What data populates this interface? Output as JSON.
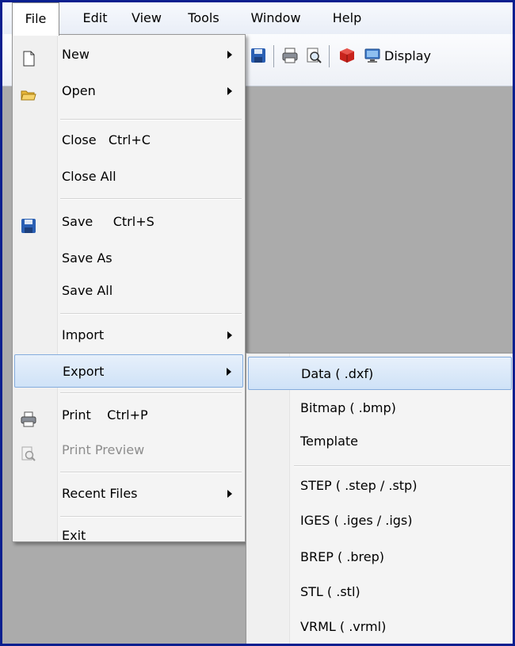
{
  "menubar": {
    "items": [
      {
        "label": "File"
      },
      {
        "label": "Edit"
      },
      {
        "label": "View"
      },
      {
        "label": "Tools"
      },
      {
        "label": "Window"
      },
      {
        "label": "Help"
      }
    ]
  },
  "toolbar": {
    "display_label": "Display"
  },
  "file_menu": {
    "new": "New",
    "open": "Open",
    "close": "Close",
    "close_shortcut": "Ctrl+C",
    "close_all": "Close All",
    "save": "Save",
    "save_shortcut": "Ctrl+S",
    "save_as": "Save As",
    "save_all": "Save All",
    "import": "Import",
    "export": "Export",
    "print": "Print",
    "print_shortcut": "Ctrl+P",
    "print_preview": "Print Preview",
    "recent_files": "Recent Files",
    "exit": "Exit"
  },
  "export_menu": {
    "data": "Data ( .dxf)",
    "bitmap": "Bitmap ( .bmp)",
    "template": "Template",
    "step": "STEP ( .step / .stp)",
    "iges": "IGES ( .iges / .igs)",
    "brep": "BREP ( .brep)",
    "stl": "STL ( .stl)",
    "vrml": "VRML ( .vrml)"
  },
  "colors": {
    "frame_border": "#0a1f8f",
    "workspace": "#ababab",
    "highlight_border": "#84acdd"
  }
}
